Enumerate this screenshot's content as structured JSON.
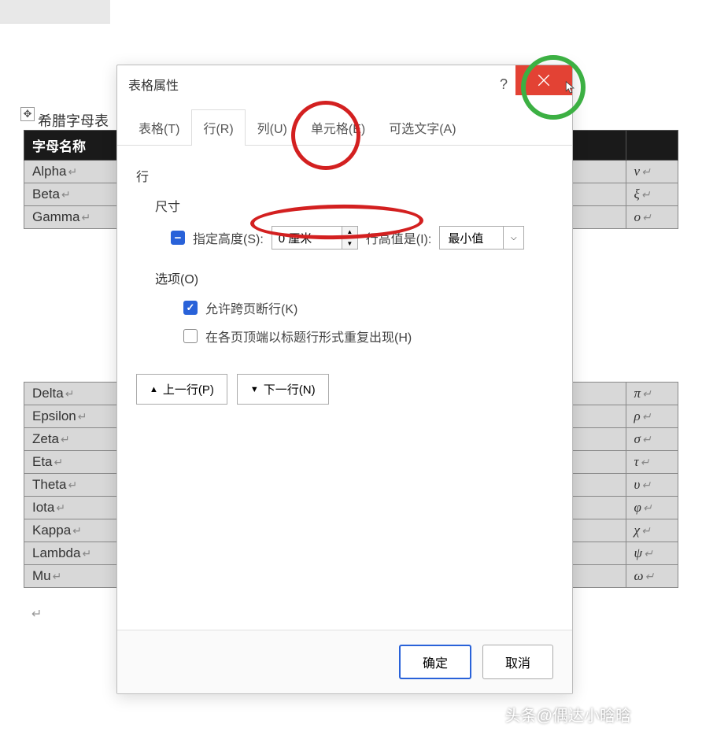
{
  "document": {
    "tableTitle": "希腊字母表",
    "headerCol1": "字母名称",
    "rowsTop": [
      "Alpha",
      "Beta",
      "Gamma"
    ],
    "rowsBottom": [
      "Delta",
      "Epsilon",
      "Zeta",
      "Eta",
      "Theta",
      "Iota",
      "Kappa",
      "Lambda",
      "Mu"
    ],
    "symbolsTop": [
      "ν",
      "ξ",
      "ο"
    ],
    "symbolsBottom": [
      "π",
      "ρ",
      "σ",
      "τ",
      "υ",
      "φ",
      "χ",
      "ψ",
      "ω"
    ]
  },
  "dialog": {
    "title": "表格属性",
    "help": "?",
    "tabs": {
      "table": "表格(T)",
      "row": "行(R)",
      "column": "列(U)",
      "cell": "单元格(E)",
      "altText": "可选文字(A)"
    },
    "body": {
      "rowLabel": "行",
      "sizeLabel": "尺寸",
      "specifyHeight": "指定高度(S):",
      "heightValue": "0 厘米",
      "rowHeightIs": "行高值是(I):",
      "rowHeightOption": "最小值",
      "optionsLabel": "选项(O)",
      "allowBreak": "允许跨页断行(K)",
      "repeatHeader": "在各页顶端以标题行形式重复出现(H)",
      "prevRow": "上一行(P)",
      "nextRow": "下一行(N)"
    },
    "footer": {
      "ok": "确定",
      "cancel": "取消"
    }
  },
  "watermark": "头条@偶达小晗晗"
}
